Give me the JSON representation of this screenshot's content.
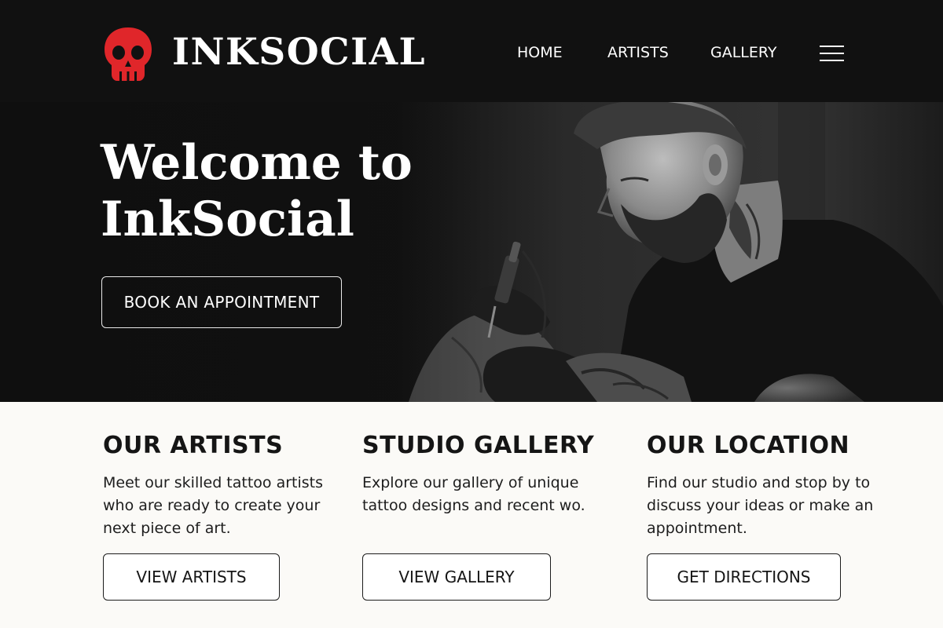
{
  "brand": {
    "name": "INKSOCIAL",
    "logo_icon": "skull-icon",
    "accent": "#e0262a"
  },
  "nav": {
    "items": [
      {
        "label": "HOME"
      },
      {
        "label": "ARTISTS"
      },
      {
        "label": "GALLERY"
      }
    ],
    "menu_icon": "hamburger-menu-icon"
  },
  "hero": {
    "title_line1": "Welcome to",
    "title_line2": "InkSocial",
    "cta_label": "BOOK AN APPOINTMENT",
    "image": "tattoo-artist-working-photo"
  },
  "features": [
    {
      "title": "OUR ARTISTS",
      "text": "Meet our skilled tattoo artists who are ready to create your next piece of art.",
      "button": "VIEW ARTISTS"
    },
    {
      "title": "STUDIO GALLERY",
      "text": "Explore our gallery of unique tattoo designs and recent wo.",
      "button": "VIEW GALLERY"
    },
    {
      "title": "OUR LOCATION",
      "text": "Find our studio and stop by to discuss your ideas or make an appointment.",
      "button": "GET DIRECTIONS"
    }
  ]
}
